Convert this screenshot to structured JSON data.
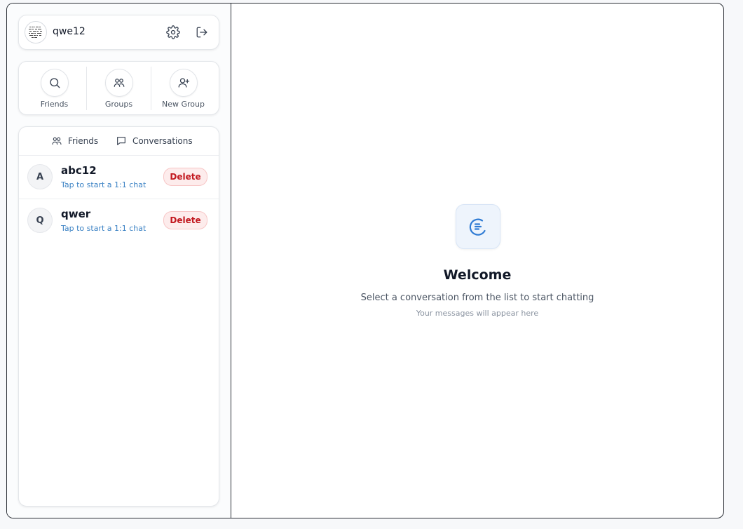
{
  "user": {
    "name": "qwe12",
    "avatar_icon": "qr-avatar-icon"
  },
  "header_icons": {
    "settings": "gear-icon",
    "logout": "logout-icon"
  },
  "actions": [
    {
      "label": "Friends",
      "icon": "search-icon"
    },
    {
      "label": "Groups",
      "icon": "users-icon"
    },
    {
      "label": "New Group",
      "icon": "user-plus-icon"
    }
  ],
  "tabs": [
    {
      "label": "Friends",
      "icon": "users-icon"
    },
    {
      "label": "Conversations",
      "icon": "chat-bubble-icon"
    }
  ],
  "conversations": [
    {
      "initial": "A",
      "name": "abc12",
      "subtitle": "Tap to start a 1:1 chat",
      "action": "Delete"
    },
    {
      "initial": "Q",
      "name": "qwer",
      "subtitle": "Tap to start a 1:1 chat",
      "action": "Delete"
    }
  ],
  "welcome": {
    "icon": "chat-logo-icon",
    "title": "Welcome",
    "subtitle": "Select a conversation from the list to start chatting",
    "hint": "Your messages will appear here"
  },
  "colors": {
    "accent": "#3b82c4",
    "danger": "#c2181f",
    "danger_bg": "#fdecec",
    "border_dark": "#2b2f36"
  }
}
